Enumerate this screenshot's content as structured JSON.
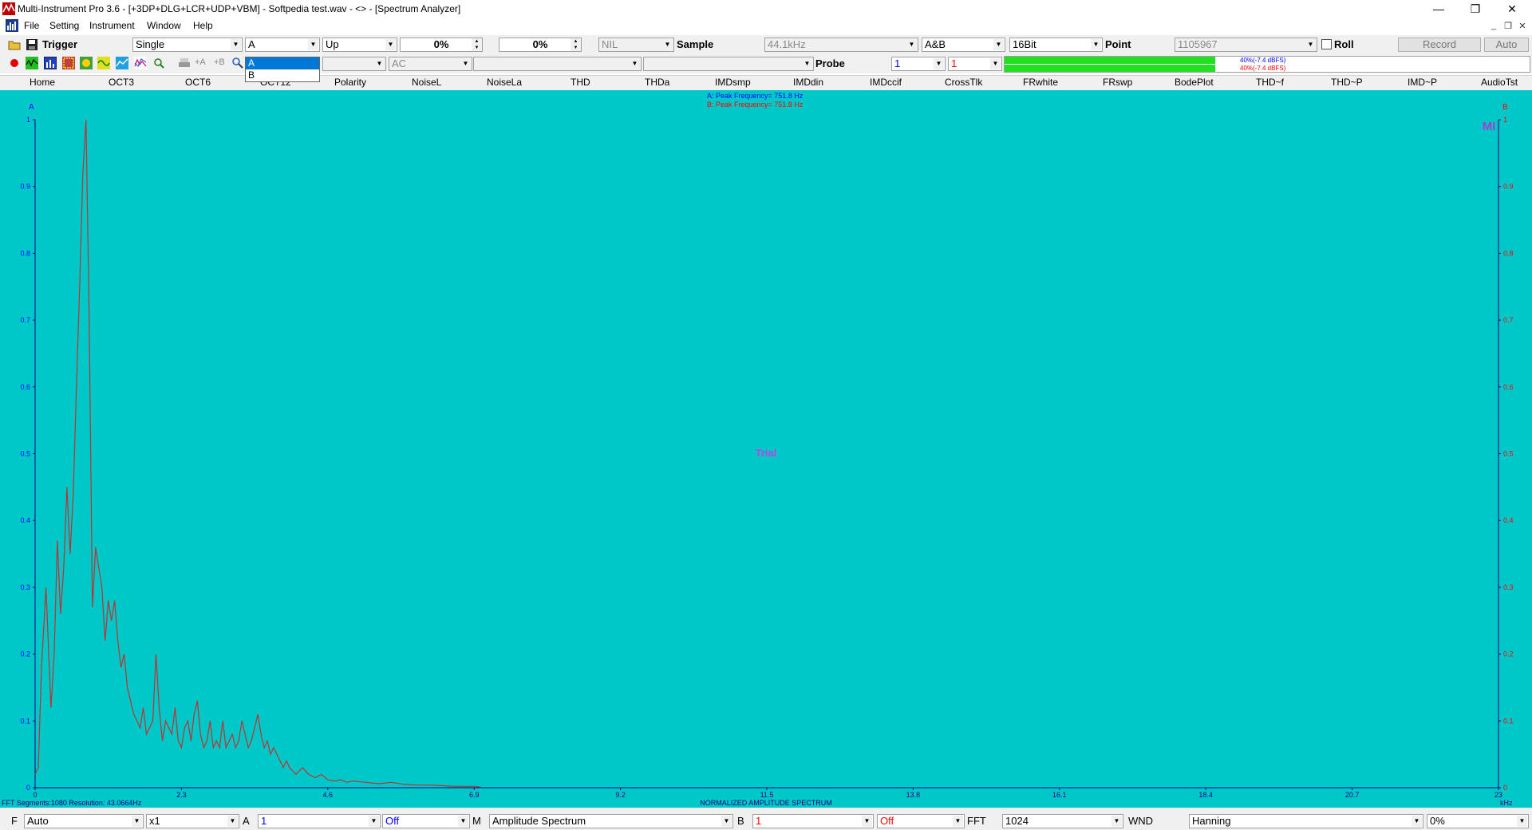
{
  "window": {
    "title": "Multi-Instrument Pro 3.6  -  [+3DP+DLG+LCR+UDP+VBM]  -  Softpedia test.wav  -  <> - [Spectrum Analyzer]",
    "minimize": "—",
    "restore": "❐",
    "close": "✕"
  },
  "menu": {
    "file": "File",
    "setting": "Setting",
    "instrument": "Instrument",
    "window": "Window",
    "help": "Help"
  },
  "toolbar1": {
    "trigger_label": "Trigger",
    "trigger_mode": "Single",
    "channel": "A",
    "edge": "Up",
    "level1": "0%",
    "level2": "0%",
    "nil": "NIL",
    "sample_label": "Sample",
    "sample_rate": "44.1kHz",
    "channels": "A&B",
    "bits": "16Bit",
    "point_label": "Point",
    "point_value": "1105967",
    "roll_label": "Roll",
    "record_label": "Record",
    "auto_label": "Auto"
  },
  "toolbar2": {
    "coupling": "AC",
    "probe_label": "Probe",
    "probe_a": "1",
    "probe_b": "1",
    "level_a": "40%(-7.4 dBFS)",
    "level_b": "40%(-7.4 dBFS)",
    "level_fraction": 0.4
  },
  "dropdown": {
    "options": [
      "A",
      "B"
    ],
    "selected": "A"
  },
  "tabs": [
    "Home",
    "OCT3",
    "OCT6",
    "OCT12",
    "Polarity",
    "NoiseL",
    "NoiseLa",
    "THD",
    "THDa",
    "IMDsmp",
    "IMDdin",
    "IMDccif",
    "CrossTlk",
    "FRwhite",
    "FRswp",
    "BodePlot",
    "THD~f",
    "THD~P",
    "IMD~P",
    "AudioTst"
  ],
  "plot": {
    "axis_left_label": "A",
    "axis_right_label": "B",
    "peak_a": "A: Peak Frequency=     751.8     Hz",
    "peak_b": "B: Peak Frequency=     751.8     Hz",
    "watermark": "Trial",
    "logo": "MI",
    "x_unit": "kHz",
    "title_bottom": "NORMALIZED AMPLITUDE SPECTRUM",
    "fft_info": "FFT Segments:1080     Resolution: 43.0664Hz",
    "line_color": "#c03030",
    "bg_color": "#00c8c8"
  },
  "chart_data": {
    "type": "line",
    "title": "NORMALIZED AMPLITUDE SPECTRUM",
    "xlabel": "kHz",
    "ylabel": "",
    "xlim": [
      0,
      23
    ],
    "ylim": [
      0,
      1
    ],
    "x_ticks": [
      "0",
      "2.3",
      "4.6",
      "6.9",
      "9.2",
      "11.5",
      "13.8",
      "16.1",
      "18.4",
      "20.7",
      "23"
    ],
    "y_ticks": [
      "0",
      "0.1",
      "0.2",
      "0.3",
      "0.4",
      "0.5",
      "0.6",
      "0.7",
      "0.8",
      "0.9",
      "1"
    ],
    "series": [
      {
        "x": [
          0,
          0.05,
          0.1,
          0.17,
          0.25,
          0.3,
          0.35,
          0.4,
          0.45,
          0.5,
          0.55,
          0.6,
          0.65,
          0.7,
          0.75,
          0.8,
          0.85,
          0.9,
          0.95,
          1.0,
          1.05,
          1.1,
          1.15,
          1.2,
          1.25,
          1.3,
          1.35,
          1.4,
          1.45,
          1.5,
          1.55,
          1.6,
          1.65,
          1.7,
          1.75,
          1.8,
          1.85,
          1.9,
          1.95,
          2.0,
          2.05,
          2.1,
          2.15,
          2.2,
          2.25,
          2.3,
          2.35,
          2.4,
          2.45,
          2.5,
          2.55,
          2.6,
          2.65,
          2.7,
          2.75,
          2.8,
          2.85,
          2.9,
          2.95,
          3.0,
          3.05,
          3.1,
          3.15,
          3.2,
          3.25,
          3.3,
          3.35,
          3.4,
          3.45,
          3.5,
          3.55,
          3.6,
          3.65,
          3.7,
          3.75,
          3.8,
          3.85,
          3.9,
          3.95,
          4.0,
          4.1,
          4.2,
          4.3,
          4.4,
          4.5,
          4.6,
          4.7,
          4.8,
          4.9,
          5.0,
          5.2,
          5.4,
          5.6,
          5.8,
          6.0,
          6.2,
          6.4,
          6.6,
          6.8,
          6.9,
          7.0
        ],
        "y": [
          0.02,
          0.03,
          0.18,
          0.3,
          0.12,
          0.2,
          0.37,
          0.26,
          0.33,
          0.45,
          0.35,
          0.44,
          0.6,
          0.75,
          0.92,
          1.0,
          0.7,
          0.27,
          0.36,
          0.33,
          0.3,
          0.22,
          0.28,
          0.25,
          0.28,
          0.22,
          0.18,
          0.2,
          0.15,
          0.13,
          0.11,
          0.1,
          0.09,
          0.12,
          0.08,
          0.09,
          0.1,
          0.2,
          0.12,
          0.07,
          0.1,
          0.09,
          0.08,
          0.12,
          0.07,
          0.06,
          0.09,
          0.1,
          0.07,
          0.11,
          0.13,
          0.08,
          0.06,
          0.07,
          0.1,
          0.06,
          0.07,
          0.06,
          0.1,
          0.06,
          0.07,
          0.08,
          0.06,
          0.07,
          0.1,
          0.08,
          0.06,
          0.07,
          0.09,
          0.11,
          0.08,
          0.06,
          0.07,
          0.05,
          0.06,
          0.05,
          0.04,
          0.03,
          0.04,
          0.03,
          0.02,
          0.03,
          0.02,
          0.015,
          0.02,
          0.012,
          0.01,
          0.012,
          0.008,
          0.01,
          0.008,
          0.006,
          0.008,
          0.005,
          0.004,
          0.004,
          0.003,
          0.002,
          0.002,
          0.002,
          0.001
        ]
      }
    ]
  },
  "statusbar": {
    "f_label": "F",
    "f_mode": "Auto",
    "zoom": "x1",
    "a_label": "A",
    "a_value": "1",
    "a_state": "Off",
    "m_label": "M",
    "m_mode": "Amplitude Spectrum",
    "b_label": "B",
    "b_value": "1",
    "b_state": "Off",
    "fft_label": "FFT",
    "fft_size": "1024",
    "wnd_label": "WND",
    "window_fn": "Hanning",
    "overlap": "0%"
  }
}
